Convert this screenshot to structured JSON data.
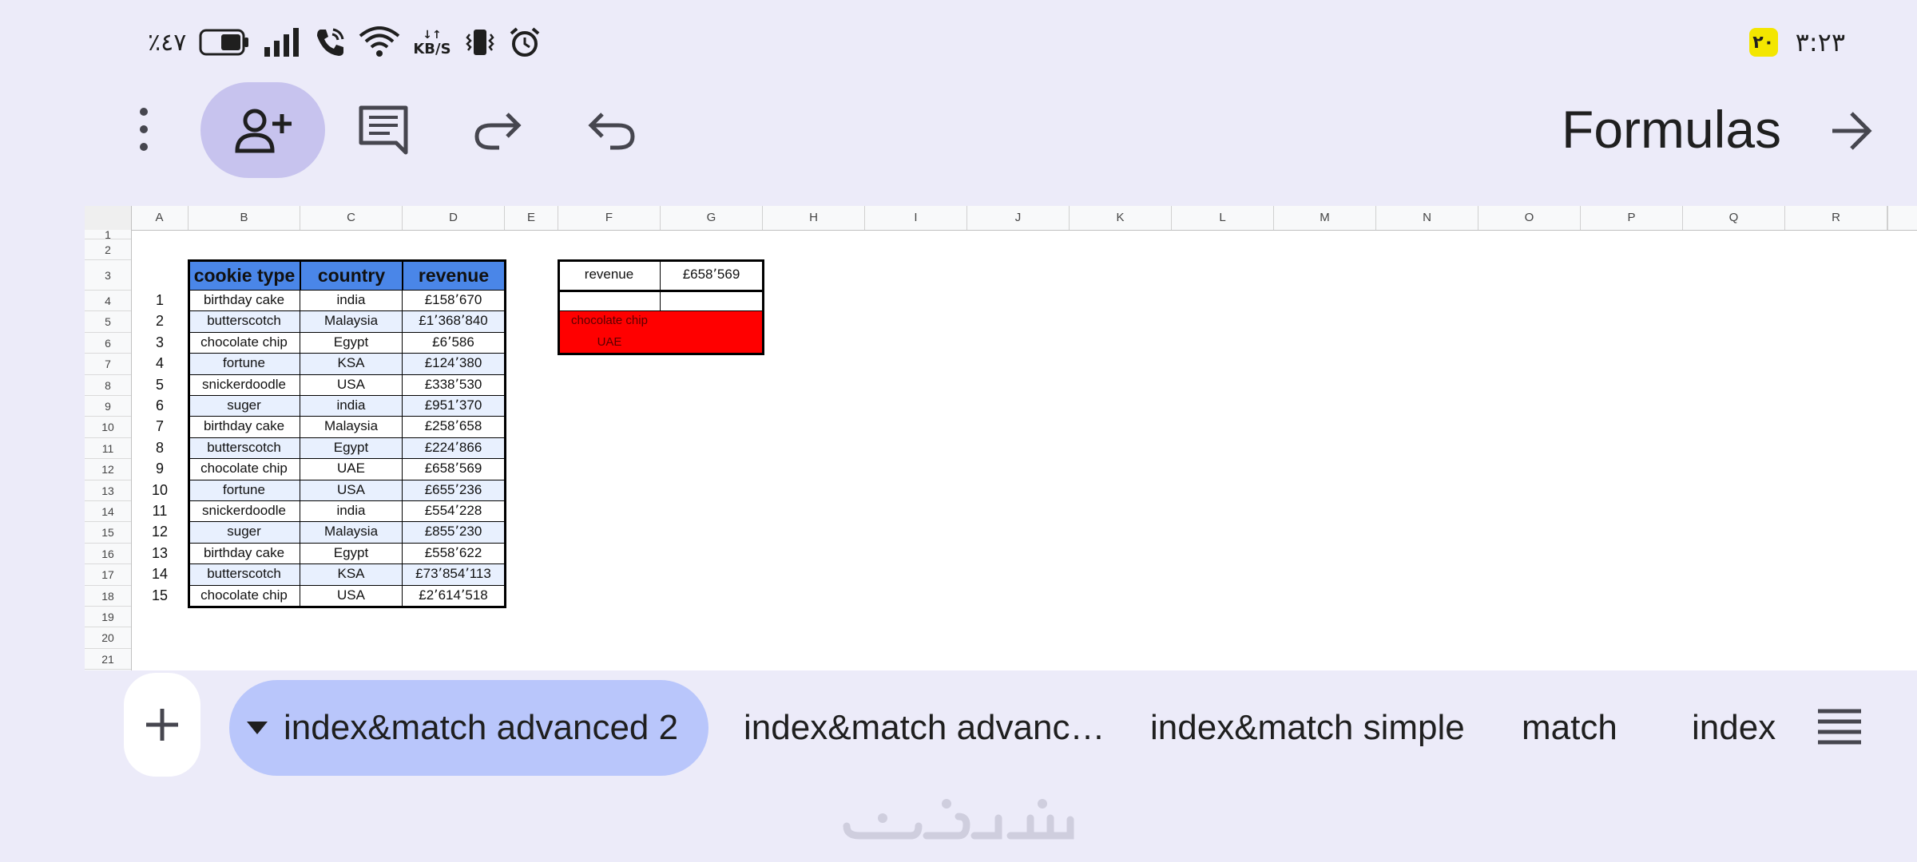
{
  "status_bar": {
    "battery_percent": "٪٤٧",
    "speed_unit": "KB/S",
    "time": "٣:٢٣",
    "badge": "٢٠"
  },
  "toolbar": {
    "title": "Formulas"
  },
  "columns": [
    "A",
    "B",
    "C",
    "D",
    "E",
    "F",
    "G",
    "H",
    "I",
    "J",
    "K",
    "L",
    "M",
    "N",
    "O",
    "P",
    "Q",
    "R"
  ],
  "rows": [
    "1",
    "2",
    "3",
    "4",
    "5",
    "6",
    "7",
    "8",
    "9",
    "10",
    "11",
    "12",
    "13",
    "14",
    "15",
    "16",
    "17",
    "18",
    "19",
    "20",
    "21"
  ],
  "table": {
    "headers": [
      "cookie type",
      "country",
      "revenue"
    ],
    "rows": [
      {
        "n": "1",
        "type": "birthday cake",
        "country": "india",
        "revenue": "£158٬670"
      },
      {
        "n": "2",
        "type": "butterscotch",
        "country": "Malaysia",
        "revenue": "£1٬368٬840"
      },
      {
        "n": "3",
        "type": "chocolate chip",
        "country": "Egypt",
        "revenue": "£6٬586"
      },
      {
        "n": "4",
        "type": "fortune",
        "country": "KSA",
        "revenue": "£124٬380"
      },
      {
        "n": "5",
        "type": "snickerdoodle",
        "country": "USA",
        "revenue": "£338٬530"
      },
      {
        "n": "6",
        "type": "suger",
        "country": "india",
        "revenue": "£951٬370"
      },
      {
        "n": "7",
        "type": "birthday cake",
        "country": "Malaysia",
        "revenue": "£258٬658"
      },
      {
        "n": "8",
        "type": "butterscotch",
        "country": "Egypt",
        "revenue": "£224٬866"
      },
      {
        "n": "9",
        "type": "chocolate chip",
        "country": "UAE",
        "revenue": "£658٬569"
      },
      {
        "n": "10",
        "type": "fortune",
        "country": "USA",
        "revenue": "£655٬236"
      },
      {
        "n": "11",
        "type": "snickerdoodle",
        "country": "india",
        "revenue": "£554٬228"
      },
      {
        "n": "12",
        "type": "suger",
        "country": "Malaysia",
        "revenue": "£855٬230"
      },
      {
        "n": "13",
        "type": "birthday cake",
        "country": "Egypt",
        "revenue": "£558٬622"
      },
      {
        "n": "14",
        "type": "butterscotch",
        "country": "KSA",
        "revenue": "£73٬854٬113"
      },
      {
        "n": "15",
        "type": "chocolate chip",
        "country": "USA",
        "revenue": "£2٬614٬518"
      }
    ]
  },
  "lookup": {
    "label": "revenue",
    "value": "£658٬569",
    "criteria_1": "chocolate chip",
    "criteria_2": "UAE"
  },
  "sheet_tabs": {
    "active": "index&match advanced 2",
    "others": [
      "index&match advanc…",
      "index&match simple",
      "match",
      "index"
    ]
  },
  "colors": {
    "background": "#ecebf9",
    "header_blue": "#4a86e8",
    "band": "#e8f0fe",
    "criteria_red": "#ff0000",
    "active_tab": "#b9c6fb",
    "share_button": "#c7c3ee"
  }
}
